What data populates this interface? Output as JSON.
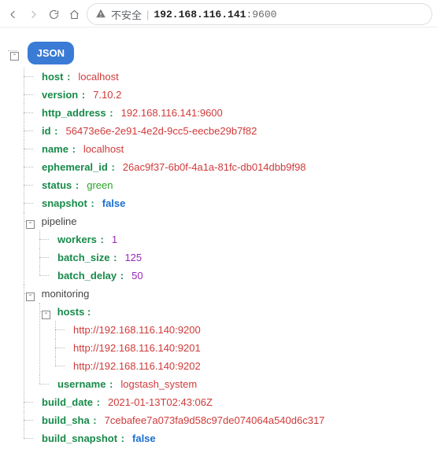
{
  "browser": {
    "insecure_label": "不安全",
    "host": "192.168.116.141",
    "port": ":9600"
  },
  "root_label": "JSON",
  "json": {
    "host": "localhost",
    "version": "7.10.2",
    "http_address": "192.168.116.141:9600",
    "id": "56473e6e-2e91-4e2d-9cc5-eecbe29b7f82",
    "name": "localhost",
    "ephemeral_id": "26ac9f37-6b0f-4a1a-81fc-db014dbb9f98",
    "status": "green",
    "snapshot": "false",
    "pipeline_label": "pipeline",
    "pipeline": {
      "workers": "1",
      "batch_size": "125",
      "batch_delay": "50"
    },
    "monitoring_label": "monitoring",
    "monitoring": {
      "hosts_label": "hosts :",
      "hosts": [
        "http://192.168.116.140:9200",
        "http://192.168.116.140:9201",
        "http://192.168.116.140:9202"
      ],
      "username": "logstash_system"
    },
    "build_date": "2021-01-13T02:43:06Z",
    "build_sha": "7cebafee7a073fa9d58c97de074064a540d6c317",
    "build_snapshot": "false"
  },
  "keys": {
    "host": "host",
    "version": "version",
    "http_address": "http_address",
    "id": "id",
    "name": "name",
    "ephemeral_id": "ephemeral_id",
    "status": "status",
    "snapshot": "snapshot",
    "workers": "workers",
    "batch_size": "batch_size",
    "batch_delay": "batch_delay",
    "username": "username",
    "build_date": "build_date",
    "build_sha": "build_sha",
    "build_snapshot": "build_snapshot"
  }
}
